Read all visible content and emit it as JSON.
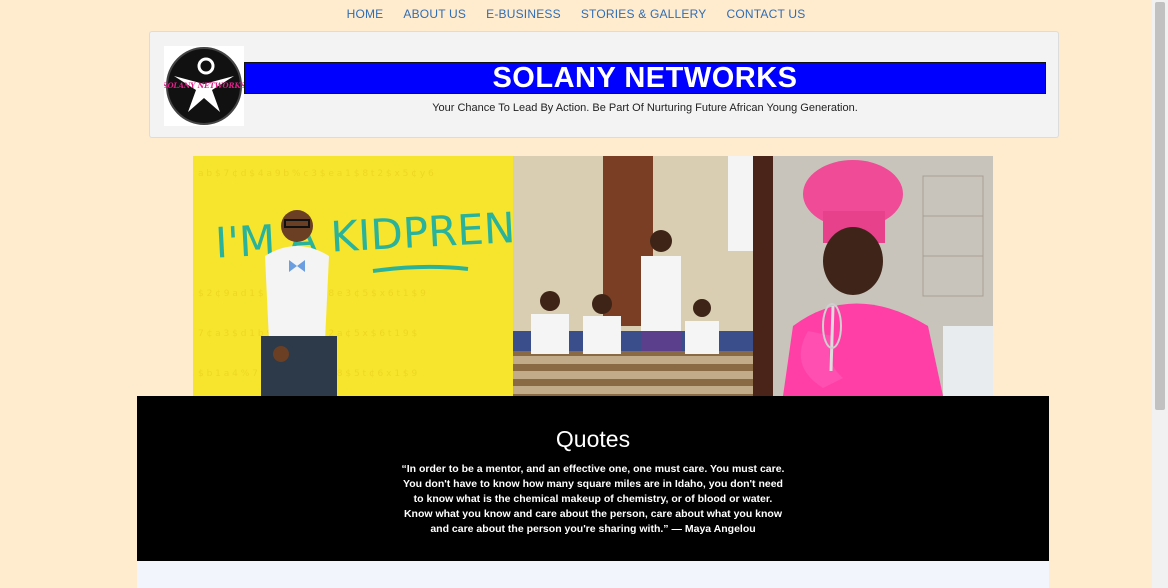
{
  "nav": {
    "items": [
      "HOME",
      "ABOUT US",
      "E-BUSINESS",
      "STORIES & GALLERY",
      "CONTACT US"
    ]
  },
  "header": {
    "logo_text": "SOLANY NETWORKS",
    "title": "SOLANY NETWORKS",
    "tagline": "Your Chance To Lead By Action. Be Part Of Nurturing Future African Young Generation."
  },
  "banner": {
    "images": [
      {
        "name": "kidpreneur-photo",
        "text": "I'M A KIDPRENEUR!"
      },
      {
        "name": "classroom-photo"
      },
      {
        "name": "chef-girl-photo"
      }
    ]
  },
  "quotes": {
    "heading": "Quotes",
    "text": "“In order to be a mentor, and an effective one, one must care. You must care. You don't have to know how many square miles are in Idaho, you don't need to know what is the chemical makeup of chemistry, or of blood or water. Know what you know and care about the person, care about what you know and care about the person you're sharing with.” — Maya Angelou"
  },
  "colors": {
    "background": "#ffebcd",
    "nav_link": "#2f6db5",
    "title_bar": "#0000ff",
    "quotes_bg": "#000000"
  }
}
